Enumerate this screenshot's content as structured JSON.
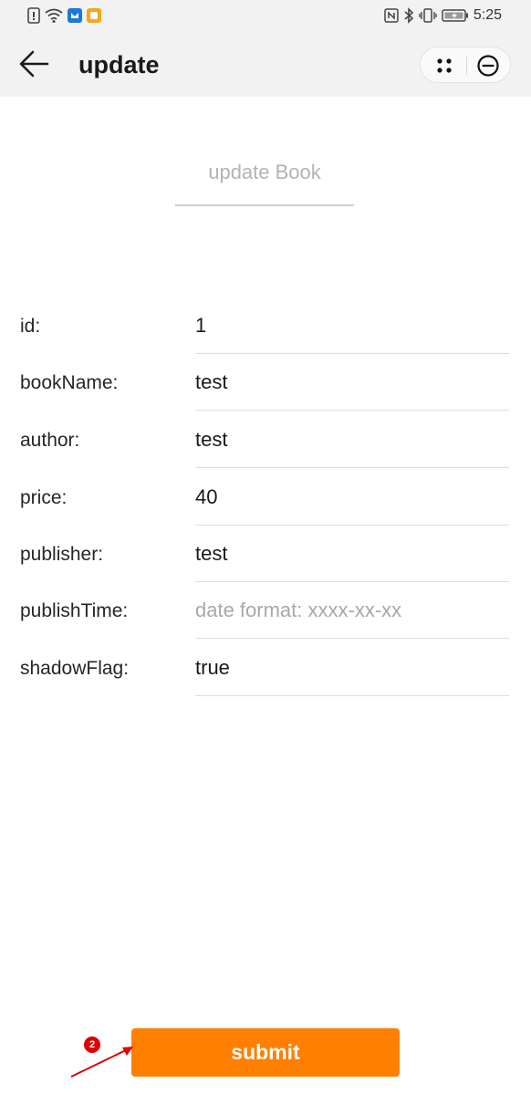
{
  "status_bar": {
    "time": "5:25",
    "left_icons": [
      "sim-alert-icon",
      "wifi-icon",
      "app-notification-icon-blue",
      "app-notification-icon-orange"
    ],
    "right_icons": [
      "nfc-icon",
      "bluetooth-icon",
      "vibrate-icon",
      "battery-charging-icon"
    ]
  },
  "app_bar": {
    "title": "update"
  },
  "header_input": {
    "placeholder": "update Book",
    "value": ""
  },
  "form": {
    "rows": [
      {
        "label": "id:",
        "value": "1",
        "placeholder": ""
      },
      {
        "label": "bookName:",
        "value": "test",
        "placeholder": ""
      },
      {
        "label": "author:",
        "value": "test",
        "placeholder": ""
      },
      {
        "label": "price:",
        "value": "40",
        "placeholder": ""
      },
      {
        "label": "publisher:",
        "value": "test",
        "placeholder": ""
      },
      {
        "label": "publishTime:",
        "value": "",
        "placeholder": "date format: xxxx-xx-xx"
      },
      {
        "label": "shadowFlag:",
        "value": "true",
        "placeholder": ""
      }
    ]
  },
  "submit": {
    "label": "submit"
  },
  "annotation": {
    "badge": "2"
  },
  "colors": {
    "accent": "#ff7f00",
    "bar_bg": "#f2f2f2",
    "annotation": "#e00000"
  }
}
